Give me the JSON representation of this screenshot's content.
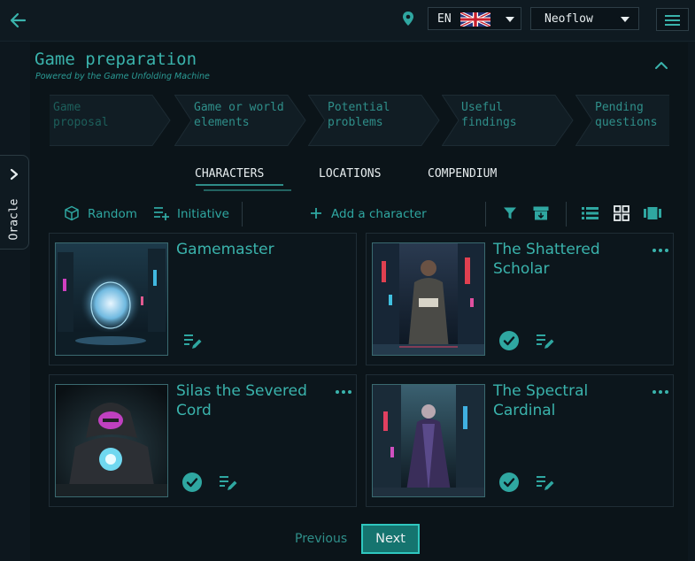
{
  "header": {
    "language": {
      "code": "EN",
      "flag_icon": "uk-flag-icon"
    },
    "theme": {
      "selected": "Neoflow"
    }
  },
  "sidebar": {
    "oracle_label": "Oracle"
  },
  "preparation": {
    "title": "Game preparation",
    "subtitle": "Powered by the Game Unfolding Machine",
    "steps": [
      {
        "line1": "Game",
        "line2": "proposal"
      },
      {
        "line1": "Game or world",
        "line2": "elements"
      },
      {
        "line1": "Potential",
        "line2": "problems"
      },
      {
        "line1": "Useful",
        "line2": "findings"
      },
      {
        "line1": "Pending",
        "line2": "questions"
      }
    ]
  },
  "tabs": [
    {
      "label": "CHARACTERS",
      "active": true
    },
    {
      "label": "LOCATIONS",
      "active": false
    },
    {
      "label": "COMPENDIUM",
      "active": false
    }
  ],
  "toolbar": {
    "random_label": "Random",
    "initiative_label": "Initiative",
    "add_label": "Add a character"
  },
  "cards": [
    {
      "name": "Gamemaster"
    },
    {
      "name": "The Shattered Scholar"
    },
    {
      "name": "Silas the Severed Cord"
    },
    {
      "name": "The Spectral Cardinal"
    }
  ],
  "pagination": {
    "previous_label": "Previous",
    "next_label": "Next"
  },
  "colors": {
    "accent": "#3ab3ac",
    "background": "#0d171e",
    "next_button": "#15746f"
  }
}
